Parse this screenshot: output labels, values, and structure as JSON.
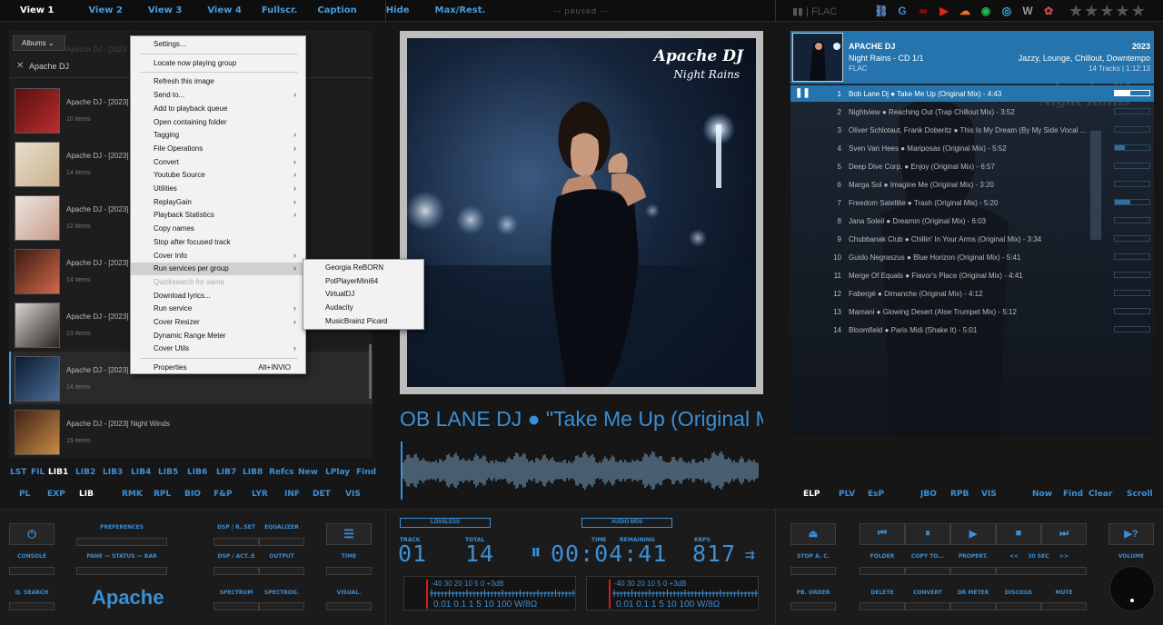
{
  "top_nav": [
    "View 1",
    "View 2",
    "View 3",
    "View 4",
    "Fullscr.",
    "Caption",
    "Hide",
    "Max/Rest."
  ],
  "status_text": "paused",
  "format_top": "| FLAC",
  "service_icons": [
    {
      "name": "link-icon",
      "glyph": "⛓",
      "color": "#5a8cc4"
    },
    {
      "name": "google-icon",
      "glyph": "G",
      "color": "#3b8fd6"
    },
    {
      "name": "lastfm-icon",
      "glyph": "∞",
      "color": "#d51007"
    },
    {
      "name": "youtube-icon",
      "glyph": "▶",
      "color": "#e62117"
    },
    {
      "name": "soundcloud-icon",
      "glyph": "☁",
      "color": "#f26f23"
    },
    {
      "name": "spotify-icon",
      "glyph": "◉",
      "color": "#1db954"
    },
    {
      "name": "allmusic-icon",
      "glyph": "◎",
      "color": "#3cb0e8"
    },
    {
      "name": "wikipedia-icon",
      "glyph": "W",
      "color": "#999999"
    },
    {
      "name": "pin-icon",
      "glyph": "✿",
      "color": "#c0504d"
    }
  ],
  "rating": {
    "value": 0,
    "max": 5
  },
  "left_panel": {
    "albums_button": "Albums",
    "filter_text": "Apache DJ",
    "albums": [
      {
        "title": "Apache DJ - [2023] N",
        "count": "10 items",
        "colors": [
          "#5a0e10",
          "#b8302e"
        ]
      },
      {
        "title": "Apache DJ - [2023] N",
        "count": "14 items",
        "colors": [
          "#e7dfcf",
          "#c9b08c"
        ]
      },
      {
        "title": "Apache DJ - [2023] N",
        "count": "12 items",
        "colors": [
          "#eae6e0",
          "#c99b8a"
        ]
      },
      {
        "title": "Apache DJ - [2023] N",
        "count": "14 items",
        "colors": [
          "#3a1a14",
          "#d4684a"
        ]
      },
      {
        "title": "Apache DJ - [2023] N",
        "count": "13 items",
        "colors": [
          "#d9d5cf",
          "#2a2522"
        ]
      },
      {
        "title": "Apache DJ - [2023] Night Rains",
        "count": "14 items",
        "colors": [
          "#0d1a30",
          "#4c6e96"
        ]
      },
      {
        "title": "Apache DJ - [2023] Night Winds",
        "count": "15 items",
        "colors": [
          "#3e2416",
          "#c98a46"
        ]
      }
    ],
    "hidden_title_top": "Apache DJ - [2023"
  },
  "context_menu": {
    "items": [
      {
        "label": "Settings...",
        "arrow": false
      },
      {
        "sep": true
      },
      {
        "label": "Locate now playing group",
        "arrow": false
      },
      {
        "sep": true
      },
      {
        "label": "Refresh this image",
        "arrow": false
      },
      {
        "label": "Send to...",
        "arrow": true
      },
      {
        "label": "Add to playback queue",
        "arrow": false
      },
      {
        "label": "Open containing folder",
        "arrow": false
      },
      {
        "label": "Tagging",
        "arrow": true
      },
      {
        "label": "File Operations",
        "arrow": true
      },
      {
        "label": "Convert",
        "arrow": true
      },
      {
        "label": "Youtube Source",
        "arrow": true
      },
      {
        "label": "Utilities",
        "arrow": true
      },
      {
        "label": "ReplayGain",
        "arrow": true
      },
      {
        "label": "Playback Statistics",
        "arrow": true
      },
      {
        "label": "Copy names",
        "arrow": false
      },
      {
        "label": "Stop after focused track",
        "arrow": false
      },
      {
        "label": "Cover Info",
        "arrow": true
      },
      {
        "label": "Run services per group",
        "arrow": true,
        "highlight": true
      },
      {
        "label": "Quicksearch for same",
        "arrow": false,
        "disabled": true
      },
      {
        "label": "Download lyrics...",
        "arrow": false
      },
      {
        "label": "Run service",
        "arrow": true
      },
      {
        "label": "Cover Resizer",
        "arrow": true
      },
      {
        "label": "Dynamic Range Meter",
        "arrow": false
      },
      {
        "label": "Cover Utils",
        "arrow": true
      },
      {
        "sep": true
      },
      {
        "label": "Properties",
        "arrow": false,
        "shortcut": "Alt+INVIO"
      }
    ],
    "submenu": [
      "Georgia ReBORN",
      "PotPlayerMini64",
      "VirtualDJ",
      "Audacity",
      "MusicBrainz Picard"
    ]
  },
  "cover": {
    "title": "Apache DJ",
    "subtitle": "Night Rains"
  },
  "now_playing_big": "OB LANE DJ ● \"Take Me Up (Original Mix)\"",
  "right_panel": {
    "artist": "APACHE DJ",
    "album": "Night Rains - CD 1/1",
    "codec": "FLAC",
    "year": "2023",
    "genre": "Jazzy, Lounge, Chillout, Downtempo",
    "count": "14 Tracks | 1:12:13",
    "watermark_title": "Apache DJ",
    "watermark_sub": "Night Rains",
    "tracks": [
      {
        "n": "1",
        "title": "Bob Lane Dj ● Take Me Up (Original Mix) - 4:43",
        "level": 0.45,
        "playing": true
      },
      {
        "n": "2",
        "title": "Nightview ● Reaching Out (Trap Chillout Mix) - 3:52",
        "level": 0
      },
      {
        "n": "3",
        "title": "Oliver Schlotaut, Frank Doberitz ● This Is My Dream (By My Side Vocal ...",
        "level": 0
      },
      {
        "n": "4",
        "title": "Sven Van Hees ● Mariposas (Original Mix) - 5:52",
        "level": 0.3
      },
      {
        "n": "5",
        "title": "Deep Dive Corp. ● Enjoy (Original Mix) - 6:57",
        "level": 0
      },
      {
        "n": "6",
        "title": "Marga Sol ● Imagine Me (Original Mix) - 3:20",
        "level": 0
      },
      {
        "n": "7",
        "title": "Freedom Satellite ● Trash (Original Mix) - 5:20",
        "level": 0.45
      },
      {
        "n": "8",
        "title": "Jana Soleil ● Dreamin (Original Mix) - 6:03",
        "level": 0
      },
      {
        "n": "9",
        "title": "Chubbanak Club ● Chillin' In Your Arms (Original Mix) - 3:34",
        "level": 0
      },
      {
        "n": "10",
        "title": "Guido Negraszus ● Blue Horizon (Original Mix) - 5:41",
        "level": 0
      },
      {
        "n": "11",
        "title": "Merge Of Equals ● Flavor's Place (Original Mix) - 4:41",
        "level": 0
      },
      {
        "n": "12",
        "title": "Fabergé ● Dimanche (Original Mix) - 4:12",
        "level": 0
      },
      {
        "n": "13",
        "title": "Mamani ● Glowing Desert (Aloe Trumpet Mix) - 5:12",
        "level": 0
      },
      {
        "n": "14",
        "title": "Bloomfield ● Paris Midi (Shake It) - 5:01",
        "level": 0
      }
    ]
  },
  "links_left_row1": [
    "LST",
    "FIL",
    "LIB1",
    "LIB2",
    "LIB3",
    "LIB4",
    "LIB5",
    "LIB6",
    "LIB7",
    "LIB8",
    "Refcs",
    "New",
    "LPlay",
    "Find"
  ],
  "links_left_row2": [
    "PL",
    "EXP",
    "LIB",
    "RMK",
    "RPL",
    "BIO",
    "F&P",
    "LYR",
    "INF",
    "DET",
    "VIS"
  ],
  "links_right_row": [
    "ELP",
    "PLV",
    "EsP",
    "JBO",
    "RPB",
    "VIS",
    "Now",
    "Find",
    "Clear",
    "Scroll"
  ],
  "bottom": {
    "left_labels": [
      "CONSOLE",
      "PREFERENCES",
      "PANE — STATUS — BAR",
      "Q. SEARCH"
    ],
    "brand": "Apache",
    "dsp_labels": [
      "DSP / R..SET",
      "EQUALIZER",
      "DSP / ACT..E",
      "OUTPUT",
      "SPECTRUM",
      "SPECTROG.",
      "TIME",
      "VISUAL."
    ],
    "tag_lossless": "LOSSLESS",
    "tag_audio": "AUDIO MDS",
    "track_label": "TRACK",
    "total_label": "TOTAL",
    "time_label": "TIME",
    "remaining_label": "REMAINING",
    "kbps_label": "KBPS",
    "track_value": "01",
    "total_value": "14",
    "time_value": "00:04:41",
    "kbps_value": "817",
    "meter_scale_top": "-40    30    20   10  5    0 +3dB",
    "meter_scale_bottom": "0.01   0.1   1  5 10   100 W/8Ω",
    "right_labels": [
      "STOP A. C.",
      "FOLDER",
      "COPY TO...",
      "PROPERT.",
      "<<",
      "30 SEC",
      ">>",
      "VOLUME",
      "PB. ORDER",
      "DELETE",
      "CONVERT",
      "DR METER",
      "DISCOGS",
      "MUTE"
    ]
  }
}
